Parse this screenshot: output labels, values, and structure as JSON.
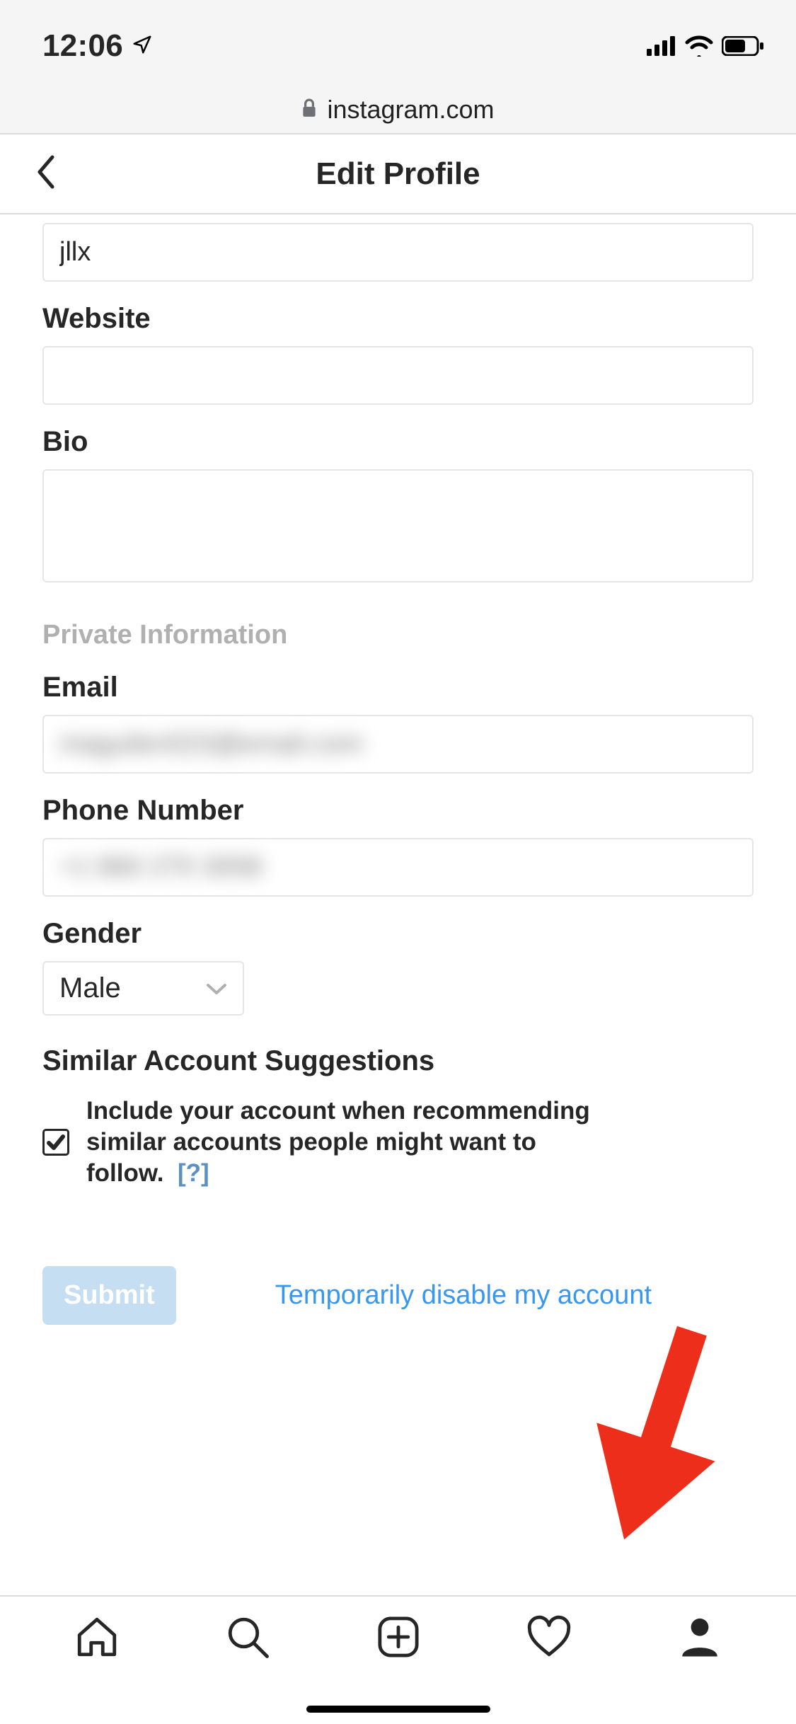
{
  "statusBar": {
    "time": "12:06"
  },
  "urlBar": {
    "domain": "instagram.com"
  },
  "header": {
    "title": "Edit Profile"
  },
  "form": {
    "username": {
      "value": "jllx"
    },
    "website": {
      "label": "Website",
      "value": ""
    },
    "bio": {
      "label": "Bio",
      "value": ""
    },
    "privateHeader": "Private Information",
    "email": {
      "label": "Email",
      "value": "maguilen023@email.com"
    },
    "phone": {
      "label": "Phone Number",
      "value": "+1 860 270 3058"
    },
    "gender": {
      "label": "Gender",
      "value": "Male"
    },
    "similar": {
      "header": "Similar Account Suggestions",
      "checkboxText": "Include your account when recommending similar accounts people might want to follow.",
      "helpLabel": "[?]"
    },
    "submitLabel": "Submit",
    "disableLabel": "Temporarily disable my account"
  },
  "colors": {
    "accent": "#3897f0",
    "arrow": "#ed2e1b"
  }
}
